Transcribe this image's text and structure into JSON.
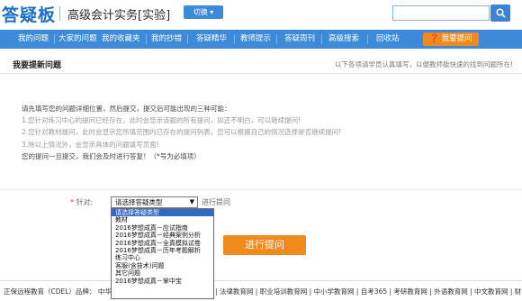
{
  "header": {
    "logo": "答疑板",
    "course_title": "高级会计实务[实验]",
    "switch_label": "切换",
    "search_placeholder": ""
  },
  "nav": {
    "items": [
      "我的问题",
      "大家的问题",
      "我的收藏夹",
      "我的抄错",
      "答疑精华",
      "教师提示",
      "答疑周刊",
      "高级搜索",
      "回收站"
    ],
    "ask_label": "我要提问"
  },
  "page": {
    "title": "我要提新问题",
    "note": "以下各项请学员认真填写，以便教师能快速的找到问题所在!"
  },
  "instructions": {
    "intro": "请先填写您的问题详细位置，然后提交，提交后可能出现的三种可能：",
    "line1": "1.您针对练习中心的提问已经存在，此时会显示该题的所有提问，如还不明白，可以继续提问!",
    "line2": "2.您针对教材提问，此时会显示您所填范围内已存在的提问列表，您可以根据自己的情况选择是否继续提问!",
    "line3": "3.除以上情况外，会显示具体的问题填写页面!",
    "line4": "您的提问一旦提交，我们会及时进行答复！（*号为必填项）"
  },
  "form": {
    "required_mark": "*",
    "label": "针对:",
    "selected": "请选择答疑类型",
    "after_text": "进行提问",
    "submit_label": "进行提问"
  },
  "dropdown": {
    "options": [
      "请选择答疑类型",
      "教材",
      "2016梦想成真－应试指南",
      "2016梦想成真－经典案例分析",
      "2016梦想成真－全真模拟试卷",
      "2016梦想成真－历年考题解析",
      "练习中心",
      "客服(含技术)问题",
      "其它问题",
      "2016梦想成真－掌中宝"
    ],
    "selected_index": 0
  },
  "footer": {
    "left": "正保远程教育（CDEL）品牌：  中华会计",
    "right": "| 法律教育网 | 职业培训教育网 | 中小学教育网 | 自考365 | 考研教育网 | 外语教育网 | 中文教育网 | 财考"
  }
}
